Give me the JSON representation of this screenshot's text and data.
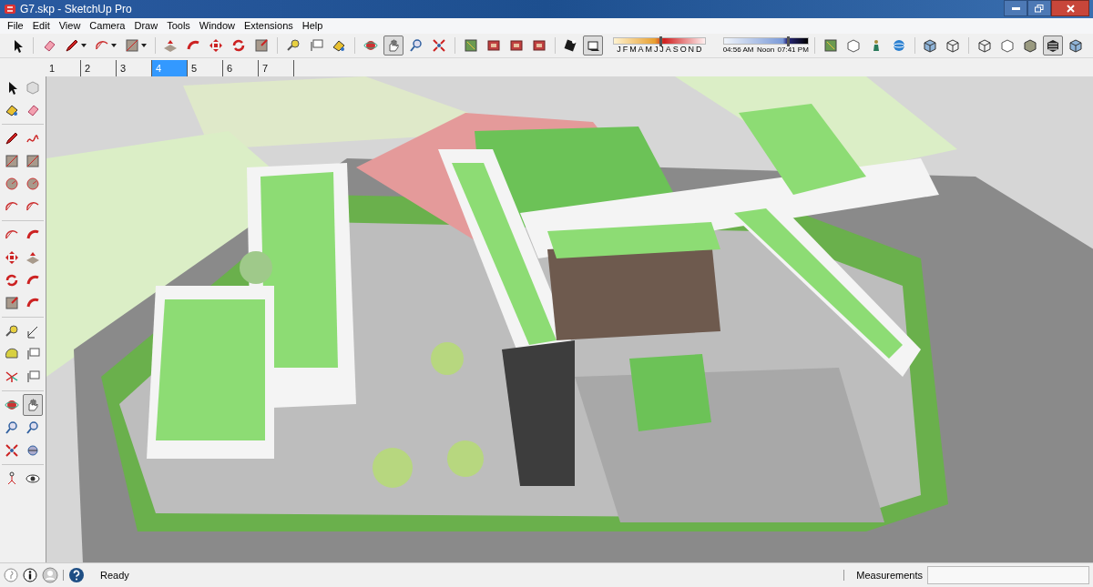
{
  "window": {
    "title": "G7.skp - SketchUp Pro"
  },
  "menu": [
    "File",
    "Edit",
    "View",
    "Camera",
    "Draw",
    "Tools",
    "Window",
    "Extensions",
    "Help"
  ],
  "toolbar": {
    "tools": [
      {
        "selected": false
      },
      {
        "selected": false
      },
      {
        "selected": false
      },
      {
        "selected": false
      },
      {
        "selected": false
      },
      {
        "selected": false
      },
      {
        "selected": false
      },
      {
        "selected": false
      },
      {
        "selected": false
      },
      {
        "selected": false
      },
      {
        "selected": false
      },
      {
        "selected": false
      },
      {
        "selected": false
      },
      {
        "selected": false
      },
      {
        "selected": true
      },
      {
        "selected": false
      },
      {
        "selected": false
      },
      {
        "selected": false
      },
      {
        "selected": false
      },
      {
        "selected": false
      },
      {
        "selected": false
      },
      {
        "selected": false
      },
      {
        "selected": true
      }
    ],
    "shadow_months": {
      "labels": [
        "J",
        "F",
        "M",
        "A",
        "M",
        "J",
        "J",
        "A",
        "S",
        "O",
        "N",
        "D"
      ],
      "level": 0.5
    },
    "shadow_time": {
      "start": "04:56 AM",
      "middle": "Noon",
      "end": "07:41 PM",
      "level": 0.75
    },
    "view_tools": [
      {
        "selected": false
      },
      {
        "selected": false
      },
      {
        "selected": false
      },
      {
        "selected": false
      },
      {
        "selected": false
      },
      {
        "selected": false
      },
      {
        "selected": false
      },
      {
        "selected": false
      },
      {
        "selected": false
      },
      {
        "selected": true
      },
      {
        "selected": false
      }
    ]
  },
  "scene_tabs": [
    {
      "label": "1",
      "selected": false
    },
    {
      "label": "2",
      "selected": false
    },
    {
      "label": "3",
      "selected": false
    },
    {
      "label": "4",
      "selected": true
    },
    {
      "label": "5",
      "selected": false
    },
    {
      "label": "6",
      "selected": false
    },
    {
      "label": "7",
      "selected": false
    }
  ],
  "left_toolbar": [
    {
      "selected": false
    },
    {
      "selected": false
    },
    {
      "selected": false
    },
    {
      "selected": false
    },
    {
      "selected": false
    },
    {
      "selected": false
    },
    {
      "selected": false
    },
    {
      "selected": false
    },
    {
      "selected": false
    },
    {
      "selected": false
    },
    {
      "selected": false
    },
    {
      "selected": false
    },
    {
      "selected": false
    },
    {
      "selected": false
    },
    {
      "selected": false
    },
    {
      "selected": false
    },
    {
      "selected": false
    },
    {
      "selected": false
    },
    {
      "selected": false
    },
    {
      "selected": false
    },
    {
      "selected": false
    },
    {
      "selected": false
    },
    {
      "selected": false
    },
    {
      "selected": false
    },
    {
      "selected": false
    },
    {
      "selected": false
    },
    {
      "selected": false
    },
    {
      "selected": true
    },
    {
      "selected": false
    },
    {
      "selected": false
    },
    {
      "selected": false
    },
    {
      "selected": false
    },
    {
      "selected": false
    },
    {
      "selected": false
    }
  ],
  "status_bar": {
    "text": "Ready",
    "measurements_label": "Measurements"
  }
}
